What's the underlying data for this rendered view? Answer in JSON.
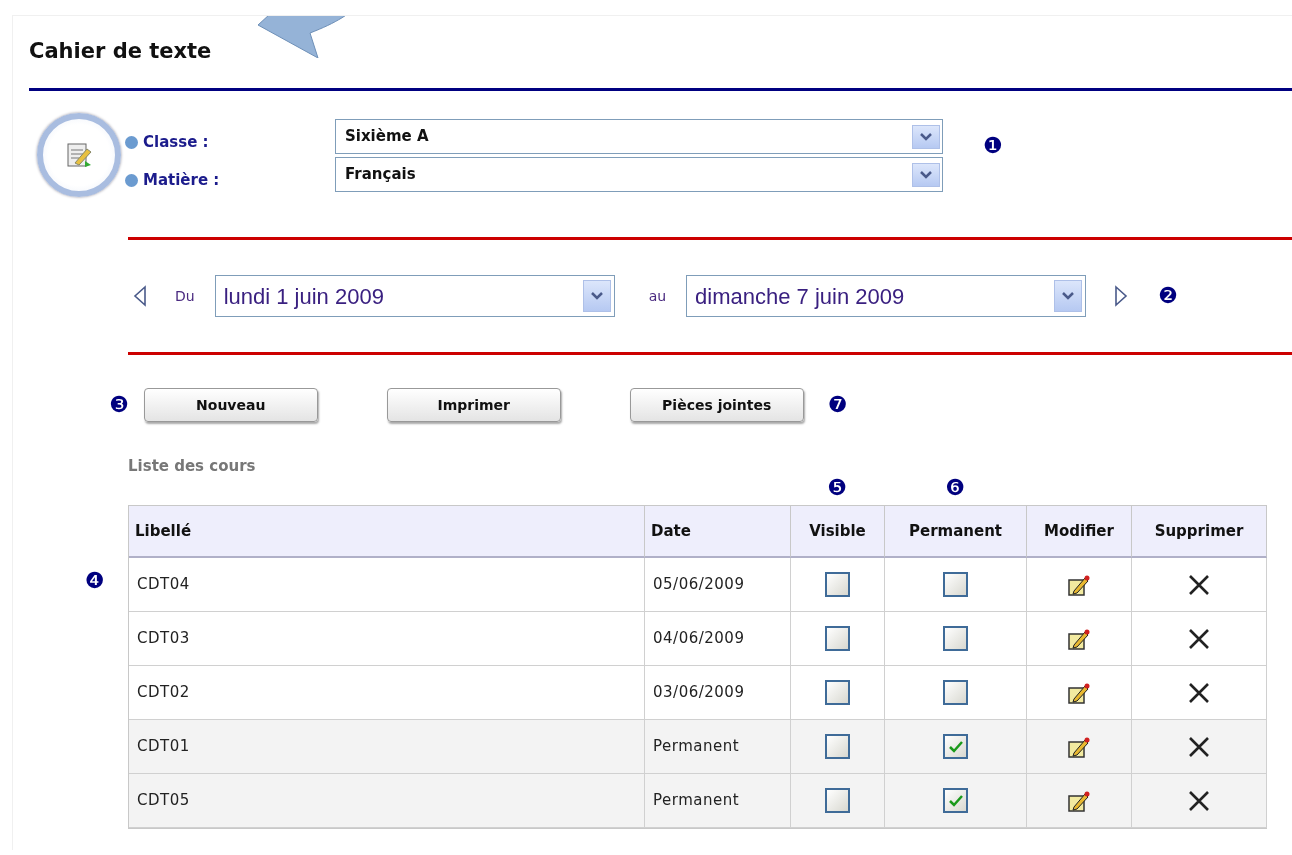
{
  "title": "Cahier de texte",
  "filters": [
    {
      "label": "Classe :",
      "value": "Sixième A"
    },
    {
      "label": "Matière :",
      "value": "Français"
    }
  ],
  "filters_marker": "❶",
  "period": {
    "from_label": "Du",
    "from_value": "lundi 1 juin 2009",
    "to_label": "au",
    "to_value": "dimanche 7 juin 2009",
    "marker": "❷"
  },
  "buttons_marker": "❸",
  "buttons": [
    "Nouveau",
    "Imprimer",
    "Pièces jointes"
  ],
  "buttons_end_marker": "❼",
  "list_title": "Liste des cours",
  "table_marker": "❹",
  "table": {
    "columns": [
      {
        "label": "Libellé"
      },
      {
        "label": "Date"
      },
      {
        "label": "Visible",
        "marker": "❺"
      },
      {
        "label": "Permanent",
        "marker": "❻"
      },
      {
        "label": "Modifier"
      },
      {
        "label": "Supprimer"
      }
    ],
    "rows": [
      {
        "label": "CDT04",
        "date": "05/06/2009",
        "visible": false,
        "permanent": false
      },
      {
        "label": "CDT03",
        "date": "04/06/2009",
        "visible": false,
        "permanent": false
      },
      {
        "label": "CDT02",
        "date": "03/06/2009",
        "visible": false,
        "permanent": false
      },
      {
        "label": "CDT01",
        "date": "Permanent",
        "visible": false,
        "permanent": true
      },
      {
        "label": "CDT05",
        "date": "Permanent",
        "visible": false,
        "permanent": true
      }
    ]
  }
}
